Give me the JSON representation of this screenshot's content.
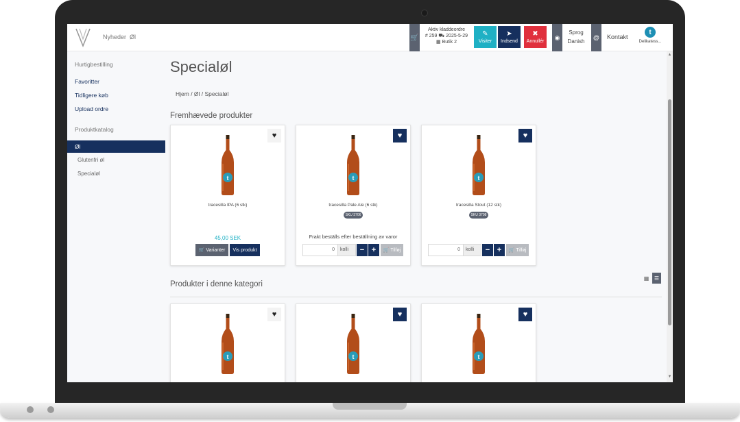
{
  "header": {
    "nav": [
      "Nyheder",
      "Øl"
    ],
    "order": {
      "title": "Aktiv kladdeordre",
      "number": "# 259",
      "date": "2025-5-29",
      "store": "Butik 2"
    },
    "buttons": {
      "visiter": "Visiter",
      "indsend": "Indsend",
      "annuller": "Annullér"
    },
    "language_label": "Sprog",
    "language_value": "Danish",
    "contact": "Kontakt",
    "user_label": "Delikatess..."
  },
  "sidebar": {
    "quick_heading": "Hurtigbestilling",
    "quick_items": [
      "Favoritter",
      "Tidligere køb",
      "Upload ordre"
    ],
    "catalog_heading": "Produktkatalog",
    "active_category": "Øl",
    "subcategories": [
      "Glutenfri øl",
      "Specialøl"
    ]
  },
  "main": {
    "title": "Specialøl",
    "breadcrumb": "Hjem / Øl / Specialøl",
    "featured_title": "Fremhævede produkter",
    "category_title": "Produkter i denne kategori",
    "featured_products": [
      {
        "name": "tracesilla IPA (6 stk)",
        "price": "45,00 SEK",
        "btn_variants": "Varianter",
        "btn_view": "Vis produkt"
      },
      {
        "name": "tracesilla Pale Ale (6 stk)",
        "tag": "SKU 3706",
        "notice": "Frakt beställs efter beställning av varor",
        "qty": "0",
        "unit": "kolli",
        "add": "Tilføj"
      },
      {
        "name": "tracesilla Stout (12 stk)",
        "tag": "SKU 3708",
        "qty": "0",
        "unit": "kolli",
        "add": "Tilføj"
      }
    ]
  },
  "colors": {
    "primary": "#16305e",
    "accent": "#1fb0c4",
    "danger": "#e0303d",
    "gray": "#5b6270"
  }
}
